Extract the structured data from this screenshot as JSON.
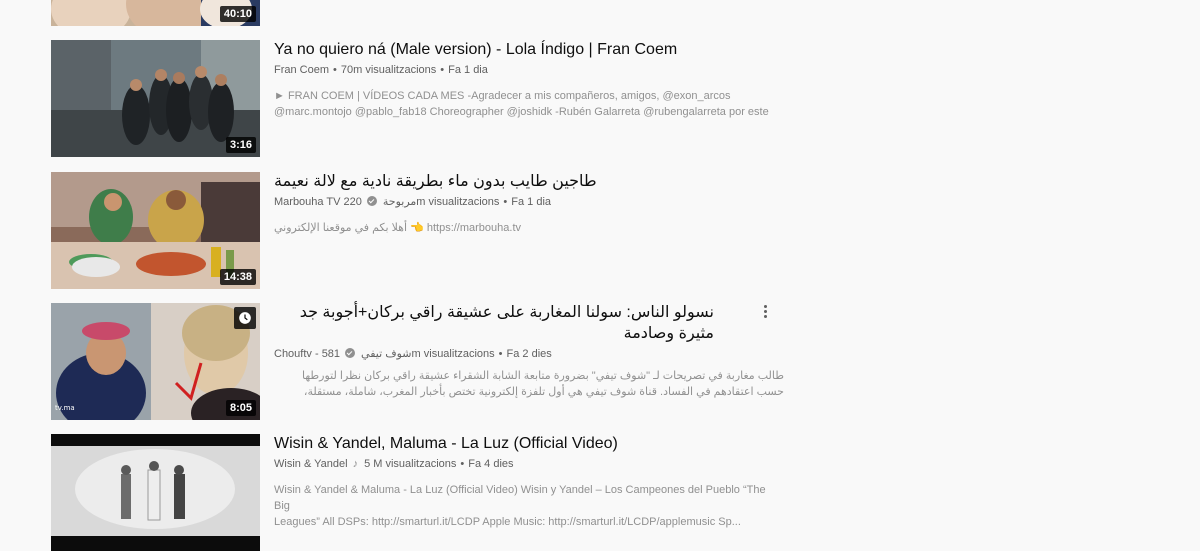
{
  "videos": [
    {
      "duration": "40:10"
    },
    {
      "title": "Ya no quiero ná (Male version) - Lola Índigo | Fran Coem",
      "channel": "Fran Coem",
      "views": "70m visualitzacions",
      "age": "Fa 1 dia",
      "description_line1": "► FRAN COEM | VÍDEOS CADA MES -Agradecer a mis compañeros, amigos, @exon_arcos",
      "description_line2": "@marc.montojo @pablo_fab18 Choreographer @joshidk -Rubén Galarreta @rubengalarreta por este",
      "duration": "3:16"
    },
    {
      "title": "طاجين طايب بدون ماء بطريقة نادية مع لالة نعيمة",
      "channel": "Marbouha TV مربوحة",
      "views": "220m visualitzacions",
      "age": "Fa 1 dia",
      "description_line1": "أهلا بكم في موقعنا الإلكتروني 👈 https://marbouha.tv",
      "duration": "14:38",
      "verified": true
    },
    {
      "title": "نسولو الناس: سولنا المغاربة على عشيقة راقي بركان+أجوبة جد مثيرة وصادمة",
      "channel": "Chouftv - شوف تيفي",
      "views": "581m visualitzacions",
      "age": "Fa 2 dies",
      "description_line1": "طالب مغاربة في تصريحات لـ \"شوف تيفي\" بضرورة متابعة الشابة الشقراء عشيقة راقي بركان نظرا لتورطها",
      "description_line2": "حسب اعتقادهم في الفساد. قناة شوف تيفي هي أول تلفزة إلكترونية تختص بأخبار المغرب، شاملة، مستقلة،",
      "duration": "8:05",
      "verified": true
    },
    {
      "title": "Wisin & Yandel, Maluma - La Luz (Official Video)",
      "channel": "Wisin & Yandel",
      "views": "5 M visualitzacions",
      "age": "Fa 4 dies",
      "description_line1": "Wisin & Yandel & Maluma - La Luz (Official Video) Wisin y Yandel – Los Campeones del Pueblo “The Big",
      "description_line2": "Leagues” All DSPs: http://smarturl.it/LCDP Apple Music: http://smarturl.it/LCDP/applemusic Sp...",
      "music_note": "♪"
    }
  ],
  "separator": "•",
  "icons": {
    "verified": "verified-check-icon",
    "watch_later": "clock-icon",
    "menu": "more-vert-icon",
    "music": "music-note-icon"
  }
}
